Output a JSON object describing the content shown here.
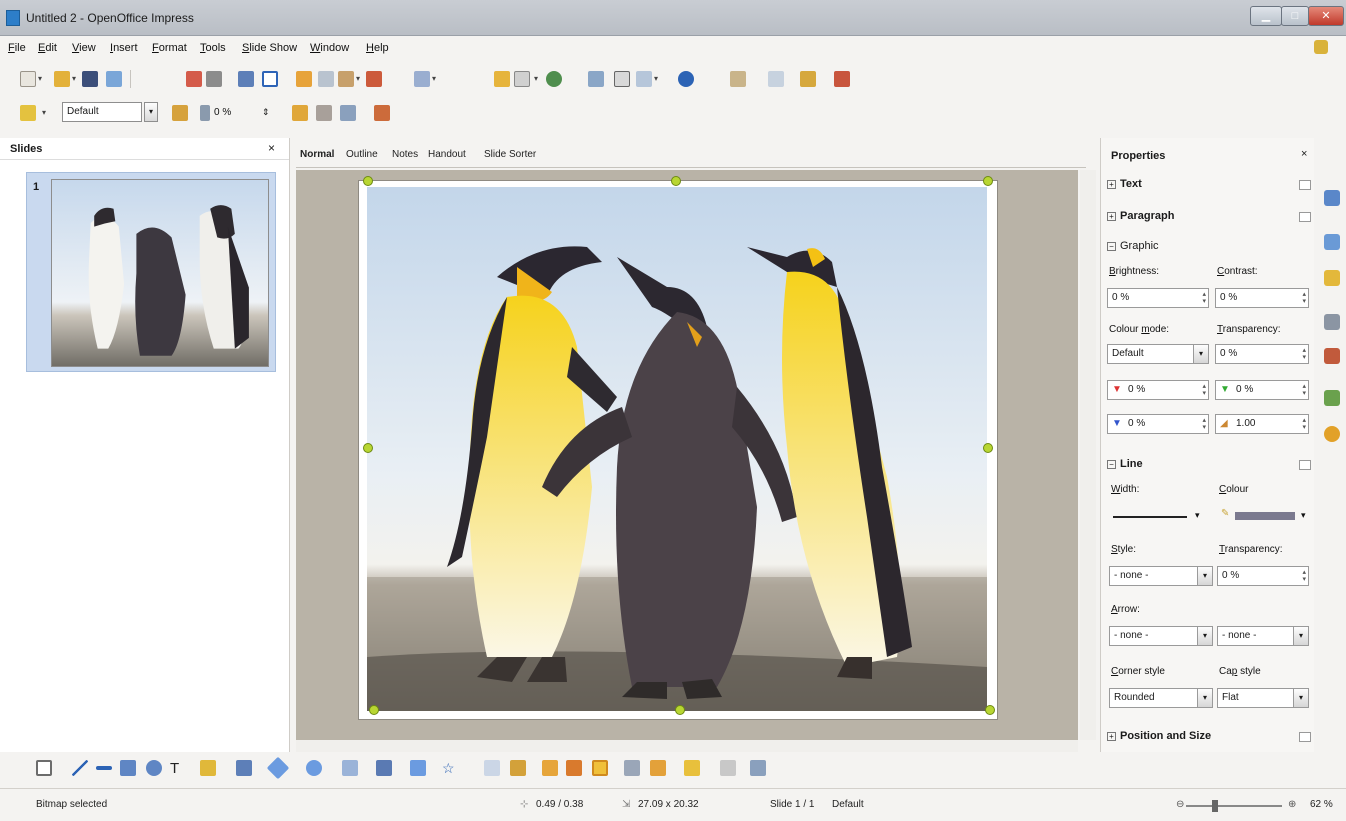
{
  "window": {
    "title": "Untitled 2 - OpenOffice Impress"
  },
  "menu": [
    {
      "first": "F",
      "rest": "ile"
    },
    {
      "first": "E",
      "rest": "dit"
    },
    {
      "first": "V",
      "rest": "iew"
    },
    {
      "first": "I",
      "rest": "nsert"
    },
    {
      "first": "F",
      "rest": "ormat",
      "pre": ""
    },
    {
      "first": "T",
      "rest": "ools"
    },
    {
      "first": "S",
      "rest": "lide Show"
    },
    {
      "first": "W",
      "rest": "indow"
    },
    {
      "first": "H",
      "rest": "elp"
    }
  ],
  "toolbar2": {
    "style_value": "Default",
    "rotation_value": "0 %"
  },
  "slides_panel": {
    "title": "Slides",
    "close": "×",
    "slide_number": "1"
  },
  "view_tabs": [
    "Normal",
    "Outline",
    "Notes",
    "Handout",
    "Slide Sorter"
  ],
  "properties": {
    "title": "Properties",
    "close": "×",
    "sections": {
      "text": "Text",
      "paragraph": "Paragraph",
      "graphic": "Graphic",
      "line": "Line",
      "position": "Position and Size"
    },
    "graphic": {
      "brightness_label_u": "B",
      "brightness_label_rest": "rightness:",
      "brightness_value": "0 %",
      "contrast_label_u": "C",
      "contrast_label_rest": "ontrast:",
      "contrast_value": "0 %",
      "colour_mode_label_pre": "Colour ",
      "colour_mode_label_u": "m",
      "colour_mode_label_rest": "ode:",
      "colour_mode_value": "Default",
      "transparency_label_u": "T",
      "transparency_label_rest": "ransparency:",
      "transparency_value": "0 %",
      "red_value": "0 %",
      "green_value": "0 %",
      "blue_value": "0 %",
      "gamma_value": "1.00"
    },
    "line": {
      "width_label_u": "W",
      "width_label_rest": "idth:",
      "colour_label_u": "C",
      "colour_label_rest": "olour",
      "style_label_u": "S",
      "style_label_rest": "tyle:",
      "style_value": "- none -",
      "transparency_label_u": "T",
      "transparency_label_rest": "ransparency:",
      "transparency_value": "0 %",
      "arrow_label_u": "A",
      "arrow_label_rest": "rrow:",
      "arrow_start_value": "- none -",
      "arrow_end_value": "- none -",
      "corner_label_u": "C",
      "corner_label_rest": "orner style",
      "corner_value": "Rounded",
      "cap_label_pre": "Ca",
      "cap_label_u": "p",
      "cap_label_rest": " style",
      "cap_value": "Flat"
    }
  },
  "status": {
    "selection": "Bitmap selected",
    "position": "0.49 / 0.38",
    "size": "27.09 x 20.32",
    "slide": "Slide 1 / 1",
    "layout": "Default",
    "zoom": "62 %"
  },
  "colors": {
    "accent_handle": "#b8d632",
    "slide_selected": "#c9d9ef"
  }
}
